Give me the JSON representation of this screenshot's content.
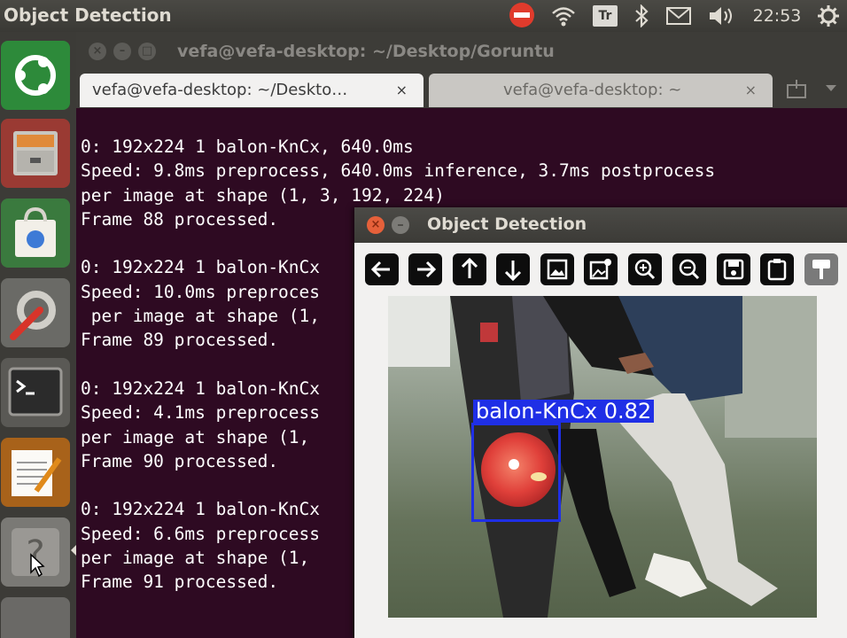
{
  "top_panel": {
    "app_title": "Object Detection",
    "keyboard_layout": "Tr",
    "clock": "22:53",
    "icons": [
      "block-icon",
      "wifi-icon",
      "keyboard-layout-icon",
      "bluetooth-icon",
      "mail-icon",
      "volume-icon",
      "gear-icon"
    ]
  },
  "launcher": {
    "items": [
      "ubuntu-dash",
      "files",
      "software-center",
      "system-settings",
      "terminal",
      "text-editor",
      "help",
      "drive"
    ]
  },
  "terminal": {
    "window_title": "vefa@vefa-desktop: ~/Desktop/Goruntu",
    "tabs": [
      {
        "label": "vefa@vefa-desktop: ~/Deskto…",
        "close": "×"
      },
      {
        "label": "vefa@vefa-desktop: ~",
        "close": "×"
      }
    ],
    "lines": [
      "0: 192x224 1 balon-KnCx, 640.0ms",
      "Speed: 9.8ms preprocess, 640.0ms inference, 3.7ms postprocess",
      "per image at shape (1, 3, 192, 224)",
      "Frame 88 processed.",
      "",
      "0: 192x224 1 balon-KnCx",
      "Speed: 10.0ms preproces",
      " per image at shape (1,",
      "Frame 89 processed.",
      "",
      "0: 192x224 1 balon-KnCx",
      "Speed: 4.1ms preprocess",
      "per image at shape (1,",
      "Frame 90 processed.",
      "",
      "0: 192x224 1 balon-KnCx",
      "Speed: 6.6ms preprocess",
      "per image at shape (1,",
      "Frame 91 processed."
    ]
  },
  "detection_window": {
    "title": "Object Detection",
    "toolbar": [
      "arrow-left-icon",
      "arrow-right-icon",
      "arrow-up-icon",
      "arrow-down-icon",
      "image-icon",
      "image-edit-icon",
      "zoom-in-icon",
      "zoom-out-icon",
      "save-icon",
      "clipboard-icon",
      "brush-icon"
    ],
    "detection": {
      "label": "balon-KnCx 0.82",
      "color": "#1f2fe6"
    }
  },
  "colors": {
    "terminal_bg": "#2e0a22",
    "panel_bg": "#3c3b37",
    "close_button": "#e6603a"
  }
}
